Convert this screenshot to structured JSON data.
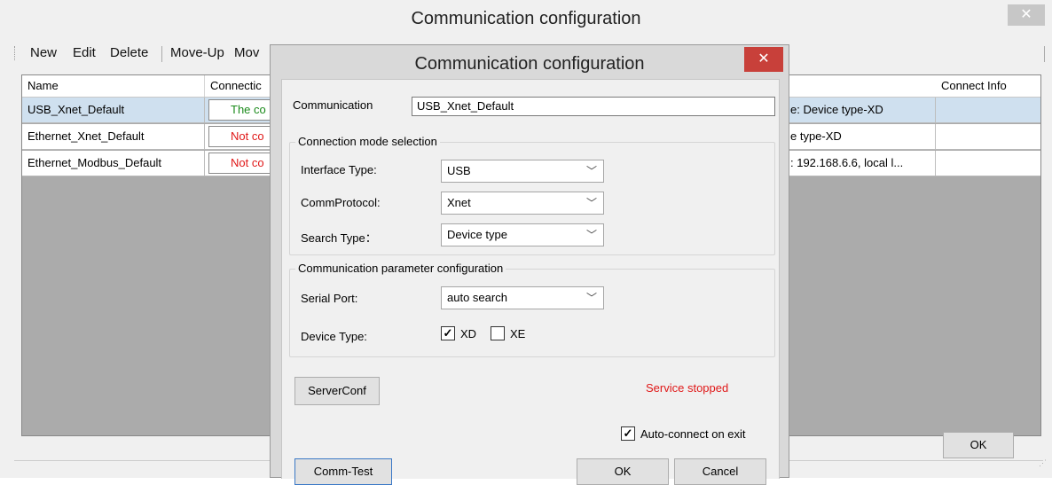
{
  "outer_window": {
    "title": "Communication configuration",
    "close_icon": "close-icon",
    "toolbar": {
      "new": "New",
      "edit": "Edit",
      "delete": "Delete",
      "move_up": "Move-Up",
      "move_down_truncated": "Mov"
    },
    "table": {
      "columns": {
        "name": "Name",
        "connection_truncated": "Connectic",
        "connect_info": "Connect Info"
      },
      "rows": [
        {
          "name": "USB_Xnet_Default",
          "status": "The co",
          "status_color": "#1a8a1a",
          "detail": "e: Device type-XD",
          "connect_info": "",
          "selected": true
        },
        {
          "name": "Ethernet_Xnet_Default",
          "status": "Not co",
          "status_color": "#e01818",
          "detail": "e type-XD",
          "connect_info": "",
          "selected": false
        },
        {
          "name": "Ethernet_Modbus_Default",
          "status": "Not co",
          "status_color": "#e01818",
          "detail": ": 192.168.6.6, local l...",
          "connect_info": "",
          "selected": false
        }
      ]
    },
    "ok_button": "OK"
  },
  "dialog": {
    "title": "Communication configuration",
    "close_icon": "close-icon",
    "communication_label": "Communication",
    "communication_value": "USB_Xnet_Default",
    "connection_mode": {
      "title": "Connection mode selection",
      "interface_type_label": "Interface Type:",
      "interface_type_value": "USB",
      "comm_protocol_label": "CommProtocol:",
      "comm_protocol_value": "Xnet",
      "search_type_label": "Search Type：",
      "search_type_value": "Device type"
    },
    "comm_params": {
      "title": "Communication parameter configuration",
      "serial_port_label": "Serial Port:",
      "serial_port_value": "auto search",
      "device_type_label": "Device Type:",
      "xd_label": "XD",
      "xd_checked": true,
      "xe_label": "XE",
      "xe_checked": false
    },
    "server_conf_button": "ServerConf",
    "service_status": "Service stopped",
    "service_status_color": "#e01818",
    "auto_connect_label": "Auto-connect on exit",
    "auto_connect_checked": true,
    "comm_test_button": "Comm-Test",
    "ok_button": "OK",
    "cancel_button": "Cancel"
  },
  "colors": {
    "accent_close": "#c8403a",
    "selected_row": "#cfe0ef",
    "status_ok": "#1a8a1a",
    "status_error": "#e01818"
  }
}
